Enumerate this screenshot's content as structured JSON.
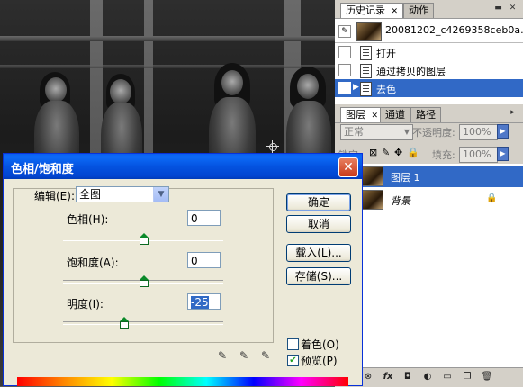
{
  "history_panel": {
    "tabs": [
      "历史记录",
      "动作"
    ],
    "snapshot_name": "20081202_c4269358ceb0a...",
    "items": [
      "打开",
      "通过拷贝的图层",
      "去色"
    ]
  },
  "layers_panel": {
    "tabs": [
      "图层",
      "通道",
      "路径"
    ],
    "blend_mode": "正常",
    "opacity_label": "不透明度:",
    "opacity_value": "100%",
    "lock_label": "锁定:",
    "fill_label": "填充:",
    "fill_value": "100%",
    "layers": [
      {
        "name": "图层 1",
        "selected": true
      },
      {
        "name": "背景",
        "selected": false
      }
    ]
  },
  "dialog": {
    "title": "色相/饱和度",
    "edit_label": "编辑(E):",
    "edit_value": "全图",
    "hue_label": "色相(H):",
    "hue_value": "0",
    "saturation_label": "饱和度(A):",
    "saturation_value": "0",
    "lightness_label": "明度(I):",
    "lightness_value": "-25",
    "buttons": {
      "ok": "确定",
      "cancel": "取消",
      "load": "载入(L)...",
      "save": "存储(S)..."
    },
    "colorize_label": "着色(O)",
    "colorize_checked": false,
    "preview_label": "预览(P)",
    "preview_checked": true
  },
  "colors": {
    "titlebar": "#0453e0",
    "selection": "#3169c6",
    "dialog_bg": "#ece9d8"
  }
}
